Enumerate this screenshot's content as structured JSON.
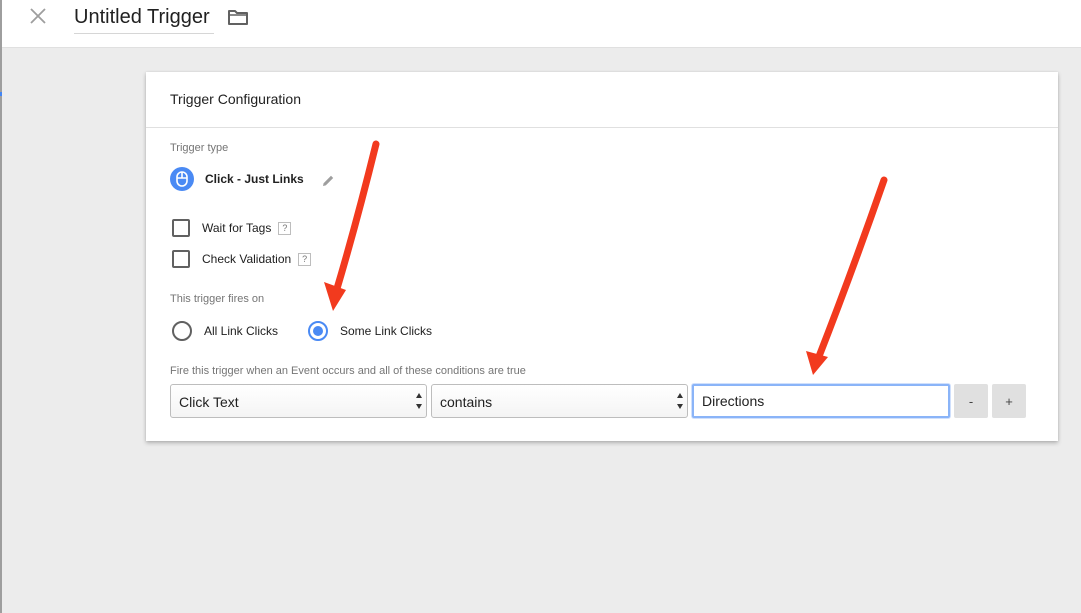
{
  "header": {
    "title": "Untitled Trigger"
  },
  "card": {
    "title": "Trigger Configuration",
    "trigger_type_label": "Trigger type",
    "trigger_type_value": "Click - Just Links",
    "options": [
      {
        "label": "Wait for Tags",
        "help": "?",
        "checked": false
      },
      {
        "label": "Check Validation",
        "help": "?",
        "checked": false
      }
    ],
    "fires_on_label": "This trigger fires on",
    "fires_on_choices": [
      {
        "label": "All Link Clicks",
        "selected": false
      },
      {
        "label": "Some Link Clicks",
        "selected": true
      }
    ],
    "condition_label": "Fire this trigger when an Event occurs and all of these conditions are true",
    "condition": {
      "variable": "Click Text",
      "operator": "contains",
      "value": "Directions"
    },
    "remove_label": "-",
    "add_label": "+"
  },
  "icons": {
    "close": "close-icon",
    "folder": "folder-icon",
    "trigger_type": "mouse-icon",
    "edit": "pencil-icon",
    "select_arrows": "updown-arrows-icon"
  },
  "colors": {
    "accent": "#4a8af4",
    "annotation_arrow": "#f23a1e",
    "background": "#ececec",
    "card": "#ffffff"
  }
}
